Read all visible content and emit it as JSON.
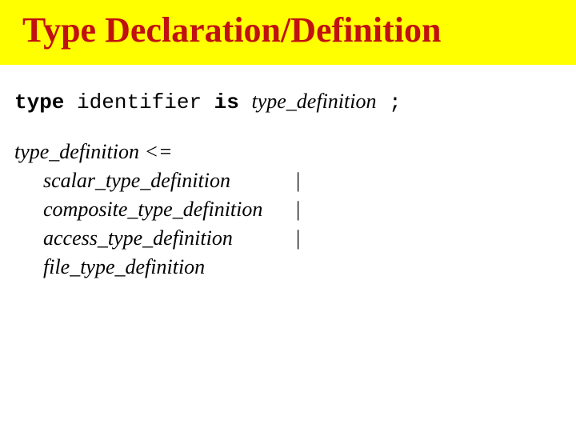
{
  "title": "Type Declaration/Definition",
  "syntax": {
    "kw_type": "type",
    "identifier": "identifier",
    "kw_is": "is",
    "type_definition": "type_definition",
    "semicolon": ";"
  },
  "grammar": {
    "head": "type_definition",
    "op": "<=",
    "alts": [
      "scalar_type_definition",
      "composite_type_definition",
      "access_type_definition",
      "file_type_definition"
    ],
    "pipe": "|"
  }
}
